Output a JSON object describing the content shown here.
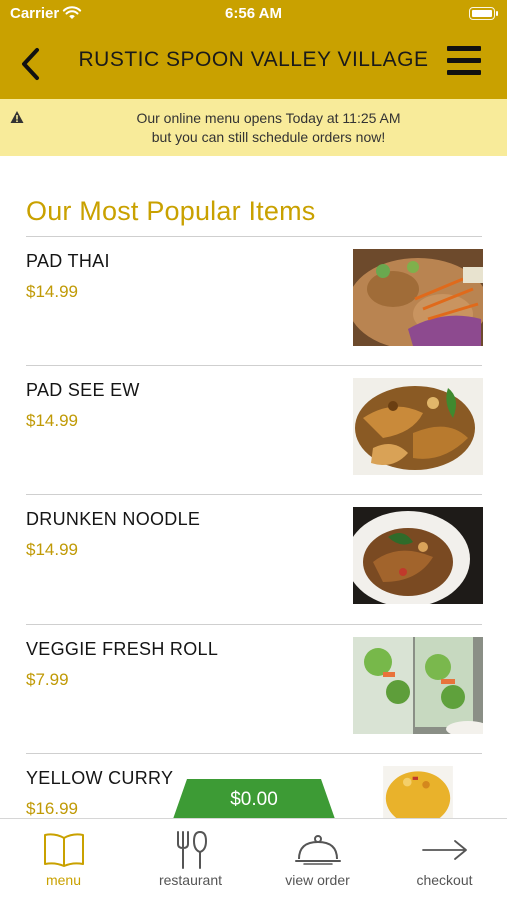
{
  "status_bar": {
    "carrier": "Carrier",
    "time": "6:56 AM"
  },
  "header": {
    "title": "RUSTIC SPOON VALLEY VILLAGE"
  },
  "notice": {
    "line1": "Our online menu opens Today at 11:25 AM",
    "line2": "but you can still schedule orders now!"
  },
  "section_title": "Our Most Popular Items",
  "items": [
    {
      "name": "PAD THAI",
      "price": "$14.99"
    },
    {
      "name": "PAD SEE EW",
      "price": "$14.99"
    },
    {
      "name": "DRUNKEN NOODLE",
      "price": "$14.99"
    },
    {
      "name": "VEGGIE FRESH ROLL",
      "price": "$7.99"
    },
    {
      "name": "YELLOW CURRY",
      "price": "$16.99"
    }
  ],
  "cart": {
    "total": "$0.00"
  },
  "tabs": [
    {
      "label": "menu",
      "icon": "book-icon"
    },
    {
      "label": "restaurant",
      "icon": "fork-knife-icon"
    },
    {
      "label": "view order",
      "icon": "cloche-icon"
    },
    {
      "label": "checkout",
      "icon": "arrow-right-icon"
    }
  ],
  "colors": {
    "brand": "#c9a100",
    "notice": "#f8eb9a",
    "cart": "#3d9b35"
  }
}
